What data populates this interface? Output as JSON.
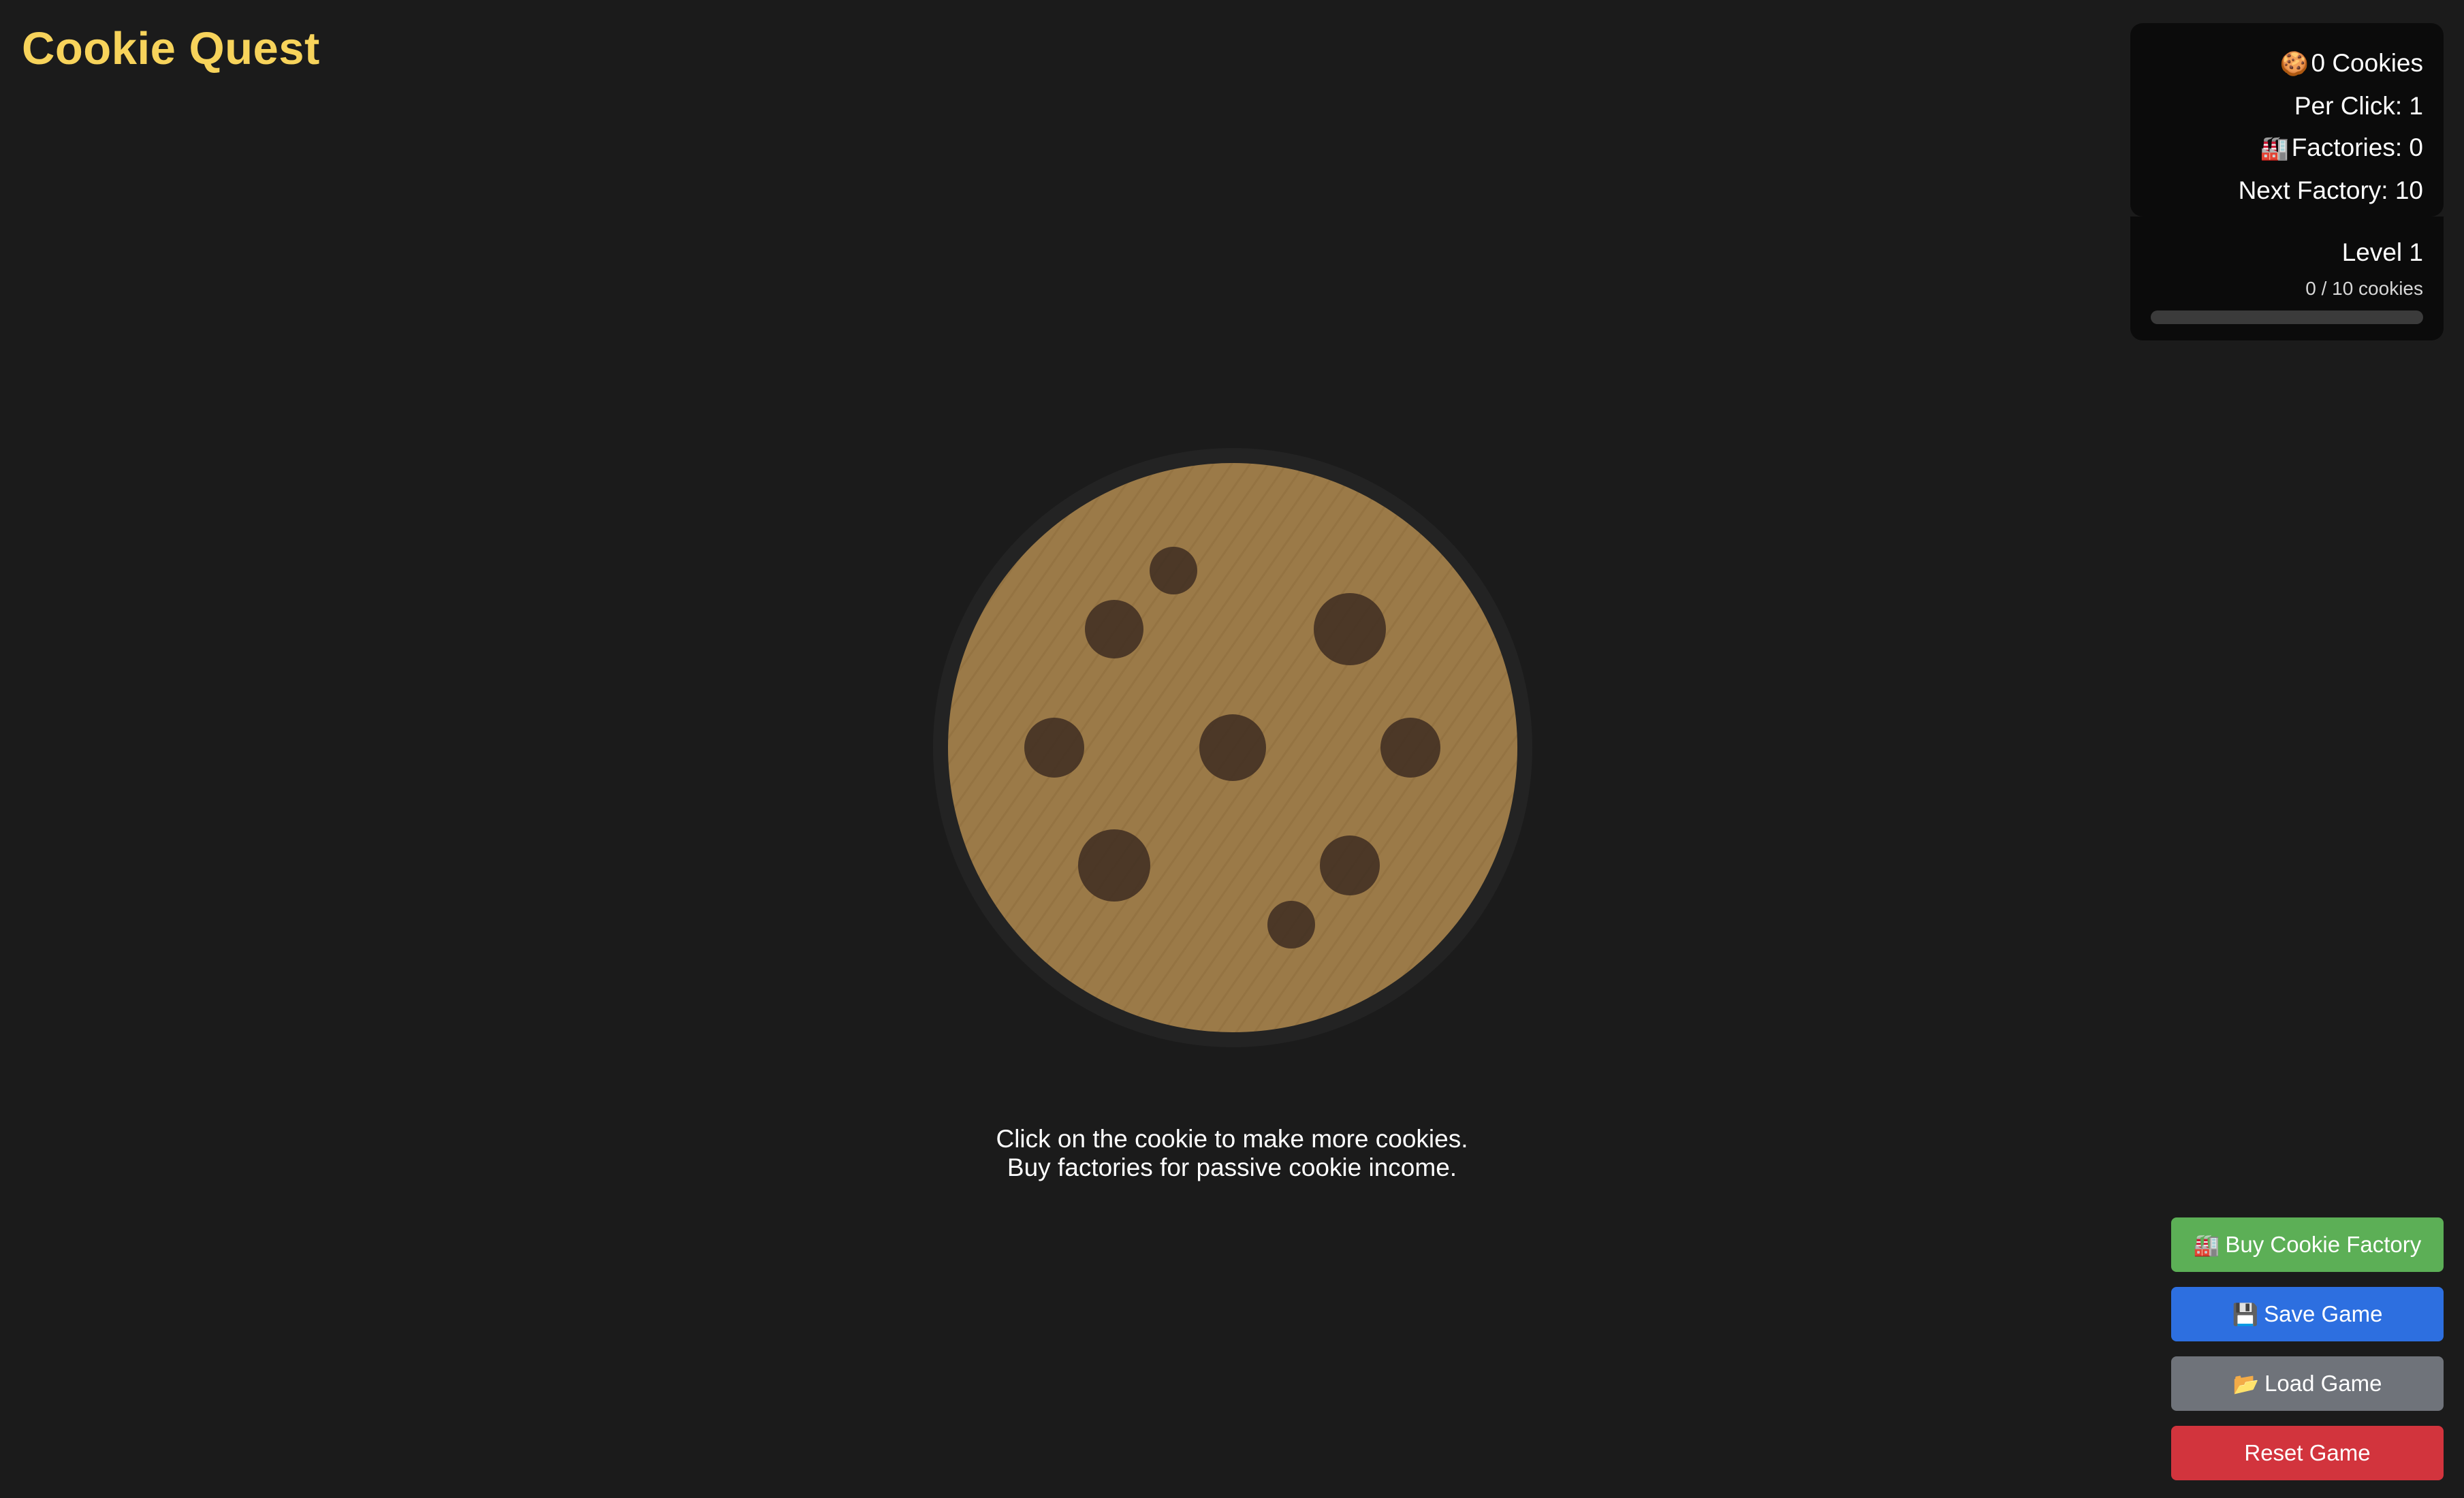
{
  "app": {
    "title": "Cookie Quest"
  },
  "stats": {
    "cookies": "0 Cookies",
    "per_click": "Per Click: 1",
    "factories": "Factories: 0",
    "next_factory": "Next Factory: 10",
    "cookie_icon": "cookie-icon",
    "factory_icon": "factory-icon"
  },
  "level": {
    "label": "Level 1",
    "progress_text": "0 / 10 cookies",
    "progress_fraction": 0
  },
  "instructions": {
    "line1": "Click on the cookie to make more cookies.",
    "line2": "Buy factories for passive cookie income."
  },
  "buttons": {
    "buy_factory": "Buy Cookie Factory",
    "save": "Save Game",
    "load": "Load Game",
    "reset": "Reset Game",
    "buy_factory_icon": "factory-icon",
    "save_icon": "floppy-disk-icon",
    "load_icon": "folder-icon"
  },
  "colors": {
    "title": "#f7d35b",
    "background": "#1b1b1b",
    "panel": "#0b0b0b",
    "cookie": "#9b7a48",
    "chip": "#3b2a20",
    "buy_button": "#5caf56",
    "save_button": "#2d6fe0",
    "load_button": "#6f737a",
    "reset_button": "#d2343d"
  }
}
